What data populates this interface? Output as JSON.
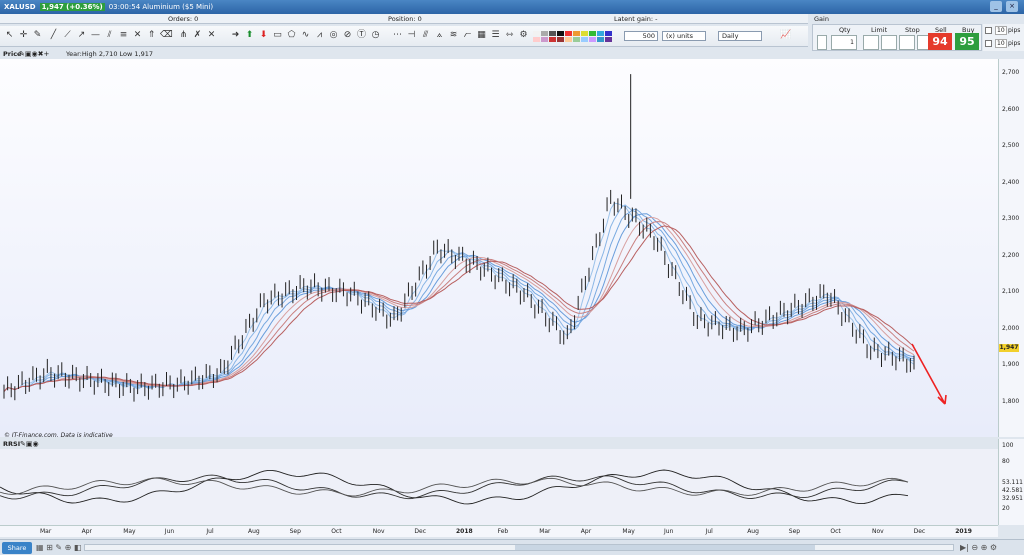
{
  "title": {
    "symbol": "XALUSD",
    "change_badge": "1,947 (+0.36%)",
    "time_and_name": "03:00:54 Aluminium ($5 Mini)"
  },
  "status": {
    "orders": "Orders: 0",
    "position": "Position: 0",
    "latent_gain": "Latent gain: -",
    "gain_today": "Gain today: -"
  },
  "toolbar": {
    "quantity": "500",
    "units": "(x) units",
    "period": "Daily"
  },
  "trade": {
    "qty_label": "Qty",
    "qty_value": "1",
    "limit_label": "Limit",
    "stop_label": "Stop",
    "sell_label": "Sell",
    "buy_label": "Buy",
    "sell_price": "94",
    "buy_price": "95",
    "pips1": "pips",
    "pips2": "pips",
    "pips_value1": "10",
    "pips_value2": "10"
  },
  "chart": {
    "price_label": "Price",
    "range_text": "Year:High 2,710 Low 1,917",
    "source_text": "© IT-Finance.com. Data is indicative",
    "indicator_label": "RRSI",
    "current_price": "1,947",
    "y_ticks": [
      "2,700",
      "2,600",
      "2,500",
      "2,400",
      "2,300",
      "2,200",
      "2,100",
      "2,000",
      "1,900",
      "1,800"
    ],
    "ind_ticks": [
      "100",
      "80",
      "53.111",
      "42.581",
      "32.951",
      "20"
    ],
    "x_ticks": [
      "Mar",
      "Apr",
      "May",
      "Jun",
      "Jul",
      "Aug",
      "Sep",
      "Oct",
      "Nov",
      "Dec",
      "2018",
      "Feb",
      "Mar",
      "Apr",
      "May",
      "Jun",
      "Jul",
      "Aug",
      "Sep",
      "Oct",
      "Nov",
      "Dec",
      "2019"
    ]
  },
  "chart_data": {
    "type": "line",
    "title": "",
    "series": [
      {
        "name": "",
        "x": [
          "Mar",
          "Apr",
          "May",
          "Jun",
          "Jul",
          "Aug",
          "Sep",
          "Oct",
          "Nov",
          "Dec",
          "2018",
          "Feb",
          "Mar",
          "Apr",
          "May",
          "Jun",
          "Jul",
          "Aug",
          "Sep",
          "Oct",
          "Nov",
          "Dec"
        ],
        "values": [
          1870,
          1920,
          1900,
          1880,
          1890,
          1920,
          2110,
          2150,
          2130,
          2060,
          2250,
          2200,
          2130,
          2010,
          2380,
          2280,
          2060,
          2030,
          2080,
          2130,
          1980,
          1947
        ]
      }
    ],
    "ylim": [
      1750,
      2750
    ]
  },
  "bottom": {
    "share": "Share"
  }
}
